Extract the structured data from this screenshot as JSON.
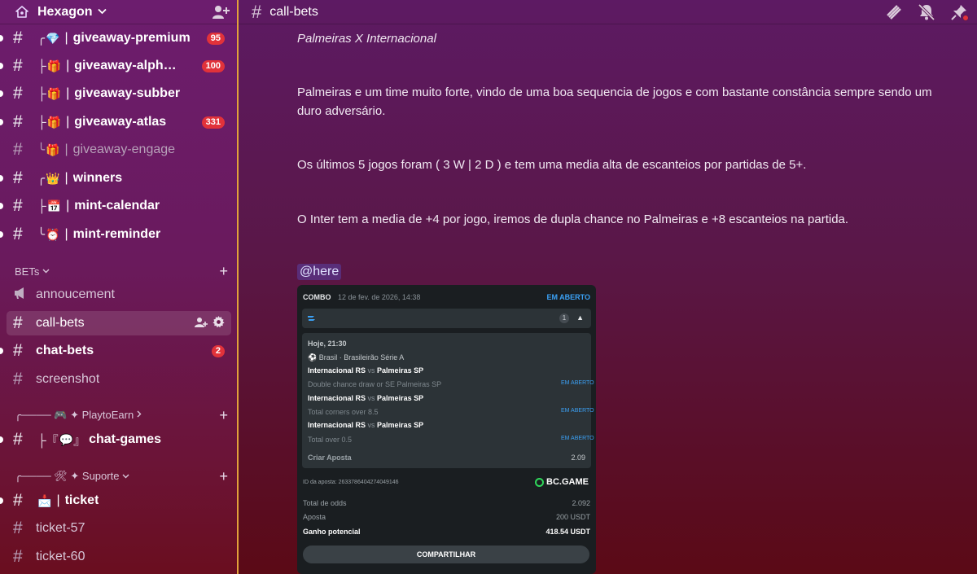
{
  "server": {
    "name": "Hexagon"
  },
  "channels": [
    {
      "tree": "╭",
      "emoji": "💎",
      "name": "giveaway-premium",
      "badge": "95"
    },
    {
      "tree": "├",
      "emoji": "🎁",
      "name": "giveaway-alpha…",
      "badge": "100"
    },
    {
      "tree": "├",
      "emoji": "🎁",
      "name": "giveaway-subber",
      "badge": ""
    },
    {
      "tree": "├",
      "emoji": "🎁",
      "name": "giveaway-atlas",
      "badge": "331"
    },
    {
      "tree": "╰",
      "emoji": "🎁",
      "name": "giveaway-engage",
      "badge": ""
    },
    {
      "tree": "╭",
      "emoji": "👑",
      "name": "winners",
      "badge": ""
    },
    {
      "tree": "├",
      "emoji": "📅",
      "name": "mint-calendar",
      "badge": ""
    },
    {
      "tree": "╰",
      "emoji": "⏰",
      "name": "mint-reminder",
      "badge": ""
    }
  ],
  "categories": {
    "bets": "BETs",
    "playtoearn": "╭──── 🎮 ✦ PlaytoEarn",
    "suporte": "╭──── 🛠 ✦ Suporte"
  },
  "bets_channels": {
    "annoucement": "annoucement",
    "callbets": "call-bets",
    "chatbets": "chat-bets",
    "chatbets_badge": "2",
    "screenshot": "screenshot"
  },
  "play_channel": {
    "prefix": "├『",
    "emoji": "💬",
    "suffix": "』",
    "name": "chat-games"
  },
  "support_channels": {
    "ticket_emoji": "📩",
    "ticket": "ticket",
    "ticket57": "ticket-57",
    "ticket60": "ticket-60"
  },
  "topbar": {
    "title": "call-bets"
  },
  "messages": {
    "line1": "Palmeiras X Internacional",
    "line2": "Palmeiras e um time muito forte, vindo de uma boa sequencia de jogos e com bastante constância sempre sendo um duro adversário.",
    "line3": "Os últimos 5 jogos foram ( 3 W | 2 D ) e tem uma media alta de escanteios por partidas de 5+.",
    "line4": "O Inter tem a media de +4 por jogo, iremos de dupla chance no Palmeiras e +8 escanteios na partida.",
    "mention": "@here"
  },
  "betcard": {
    "combo": "COMBO",
    "date": "12 de fev. de 2026, 14:38",
    "status": "EM ABERTO",
    "count": "1",
    "time": "Hoje, 21:30",
    "league": "Brasil · Brasileirão Série A",
    "team1": "Internacional RS",
    "vs": "vs",
    "team2": "Palmeiras SP",
    "market1": "Double chance draw or SE Palmeiras SP",
    "market2": "Total corners over 8.5",
    "market3": "Total over 0.5",
    "leg_status": "EM ABERTO",
    "criar": "Criar Aposta",
    "criar_odd": "2.09",
    "bet_id": "ID da aposta: 26337864042740491​46",
    "brand": "BC.GAME",
    "total_odds_label": "Total de odds",
    "total_odds": "2.092",
    "stake_label": "Aposta",
    "stake": "200 USDT",
    "gain_label": "Ganho potencial",
    "gain": "418.54 USDT",
    "share": "COMPARTILHAR"
  },
  "colors": {
    "accent_border": "#e2a23a",
    "badge": "#e1323a",
    "link_blue": "#3ba1f5"
  }
}
